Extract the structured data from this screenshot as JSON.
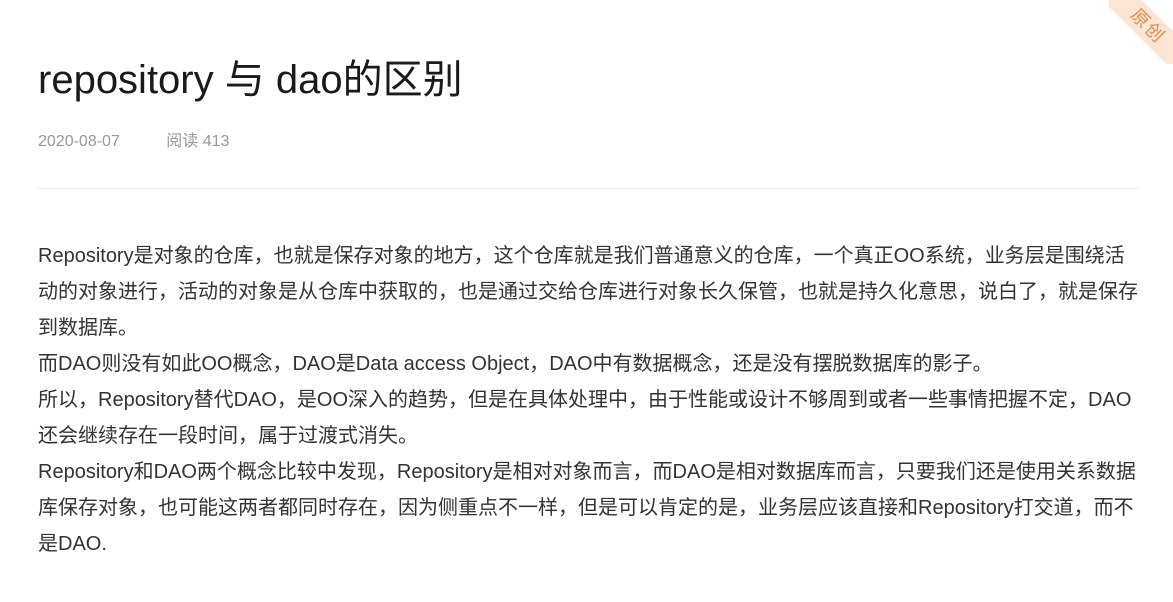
{
  "badge": {
    "label": "原创"
  },
  "article": {
    "title": "repository 与 dao的区别",
    "date": "2020-08-07",
    "reads": "阅读 413",
    "paragraphs": [
      "Repository是对象的仓库，也就是保存对象的地方，这个仓库就是我们普通意义的仓库，一个真正OO系统，业务层是围绕活动的对象进行，活动的对象是从仓库中获取的，也是通过交给仓库进行对象长久保管，也就是持久化意思，说白了，就是保存到数据库。",
      "而DAO则没有如此OO概念，DAO是Data access Object，DAO中有数据概念，还是没有摆脱数据库的影子。",
      "所以，Repository替代DAO，是OO深入的趋势，但是在具体处理中，由于性能或设计不够周到或者一些事情把握不定，DAO还会继续存在一段时间，属于过渡式消失。",
      "Repository和DAO两个概念比较中发现，Repository是相对对象而言，而DAO是相对数据库而言，只要我们还是使用关系数据库保存对象，也可能这两者都同时存在，因为侧重点不一样，但是可以肯定的是，业务层应该直接和Repository打交道，而不是DAO."
    ]
  },
  "colors": {
    "title": "#1a1a1a",
    "meta": "#999999",
    "body": "#333333",
    "badge_bg": "#fbe6d6",
    "badge_text": "#e98a4a"
  }
}
